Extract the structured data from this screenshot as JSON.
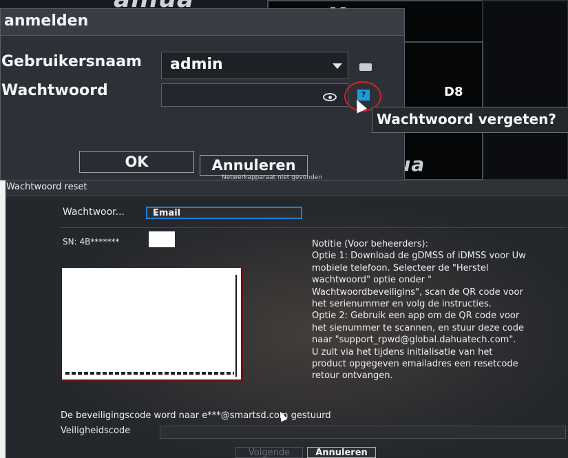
{
  "top_photo": {
    "brand_text": "alhua",
    "brand_text_small": "alhua",
    "camera_label": "D8",
    "net_status": "Netwerkapparaat niet gevonden"
  },
  "login": {
    "title": "anmelden",
    "username_label": "Gebruikersnaam",
    "username_value": "admin",
    "password_label": "Wachtwoord",
    "password_value": "",
    "forgot_tooltip": "Wachtwoord vergeten?",
    "help_glyph": "?",
    "ok_label": "OK",
    "cancel_label": "Annuleren"
  },
  "reset": {
    "title": "Wachtwoord reset",
    "method_label": "Wachtwoor...",
    "method_value": "Email",
    "sn_label": "SN: 4B*******",
    "note_lines": [
      "Notitie (Voor beheerders):",
      "Optie 1: Download de gDMSS of iDMSS voor Uw",
      "mobiele telefoon. Selecteer de \"Herstel",
      "wachtwoord\" optie onder \"",
      "Wachtwoordbeveiligins\", scan de QR code voor",
      "het serienummer en volg de instructies.",
      "Optie 2: Gebruik een app om de QR code voor",
      "het sienummer te scannen, en stuur deze code",
      "naar \"support_rpwd@global.dahuatech.com\".",
      "U zult via het tijdens initialisatie van het",
      "product opgegeven emailadres een resetcode",
      "retour ontvangen."
    ],
    "sent_message": "De beveiligingscode word naar e***@smartsd.com gestuurd",
    "code_label": "Veiligheidscode",
    "code_value": "",
    "next_label": "Volgende",
    "cancel_label": "Annuleren"
  },
  "colors": {
    "accent": "#1f7fd3",
    "highlight_circle": "#d32222",
    "dialog_bg": "#2d3036"
  },
  "icons": {
    "dropdown": "chevron-down-icon",
    "keyboard": "keyboard-icon",
    "show_password": "eye-icon",
    "forgot_password": "help-icon",
    "pointer": "cursor-icon"
  }
}
